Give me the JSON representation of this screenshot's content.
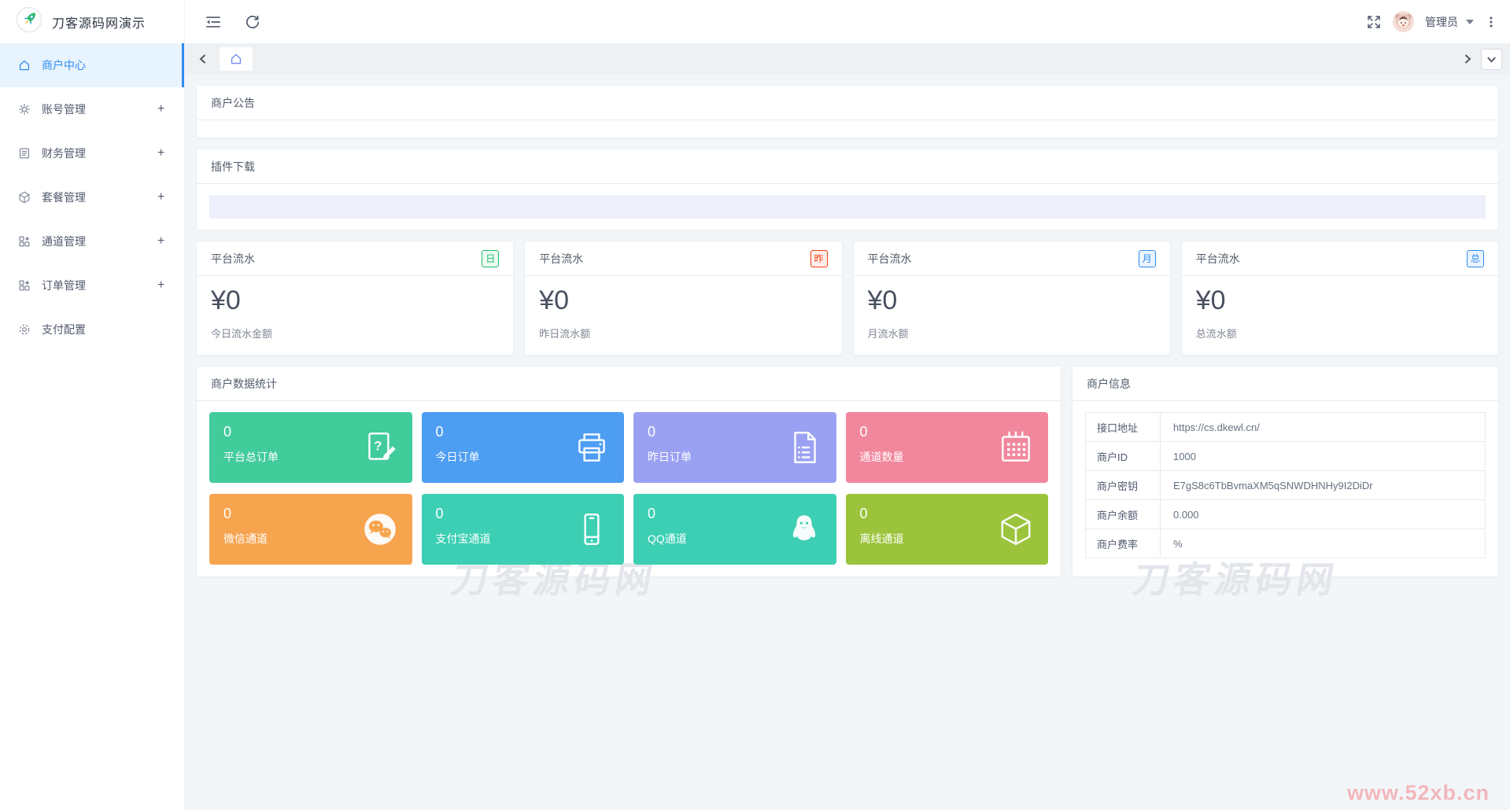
{
  "app": {
    "title": "刀客源码网演示"
  },
  "sidebar": {
    "items": [
      {
        "label": "商户中心",
        "expand": ""
      },
      {
        "label": "账号管理",
        "expand": "+"
      },
      {
        "label": "财务管理",
        "expand": "+"
      },
      {
        "label": "套餐管理",
        "expand": "+"
      },
      {
        "label": "通道管理",
        "expand": "+"
      },
      {
        "label": "订单管理",
        "expand": "+"
      },
      {
        "label": "支付配置",
        "expand": ""
      }
    ]
  },
  "header": {
    "user_name": "管理员"
  },
  "announcement": {
    "title": "商户公告"
  },
  "plugins": {
    "title": "插件下载"
  },
  "stat_cards": [
    {
      "title": "平台流水",
      "badge": "日",
      "badge_color": "#19be6b",
      "badge_bg": "#edf9f1",
      "value": "¥0",
      "label": "今日流水金额"
    },
    {
      "title": "平台流水",
      "badge": "昨",
      "badge_color": "#ed4014",
      "badge_bg": "#feeeeb",
      "value": "¥0",
      "label": "昨日流水额"
    },
    {
      "title": "平台流水",
      "badge": "月",
      "badge_color": "#2d8cf0",
      "badge_bg": "#eaf4fe",
      "value": "¥0",
      "label": "月流水额"
    },
    {
      "title": "平台流水",
      "badge": "总",
      "badge_color": "#2d8cf0",
      "badge_bg": "#eaf4fe",
      "value": "¥0",
      "label": "总流水额"
    }
  ],
  "data_stats": {
    "title": "商户数据统计",
    "tiles": [
      {
        "value": "0",
        "label": "平台总订单",
        "color": "#42cb9b",
        "icon": "order-edit-icon"
      },
      {
        "value": "0",
        "label": "今日订单",
        "color": "#4d9df2",
        "icon": "printer-icon"
      },
      {
        "value": "0",
        "label": "昨日订单",
        "color": "#9ba1f2",
        "icon": "document-icon"
      },
      {
        "value": "0",
        "label": "通道数量",
        "color": "#f1879d",
        "icon": "calendar-icon"
      },
      {
        "value": "0",
        "label": "微信通道",
        "color": "#f7a44f",
        "icon": "wechat-icon"
      },
      {
        "value": "0",
        "label": "支付宝通道",
        "color": "#3dcfb4",
        "icon": "phone-icon"
      },
      {
        "value": "0",
        "label": "QQ通道",
        "color": "#3dcfb4",
        "icon": "qq-icon"
      },
      {
        "value": "0",
        "label": "离线通道",
        "color": "#9bc43c",
        "icon": "package-icon"
      }
    ]
  },
  "merchant_info": {
    "title": "商户信息",
    "rows": [
      {
        "label": "接口地址",
        "value": "https://cs.dkewl.cn/"
      },
      {
        "label": "商户ID",
        "value": "1000"
      },
      {
        "label": "商户密钥",
        "value": "E7gS8c6TbBvmaXM5qSNWDHNHy9I2DiDr"
      },
      {
        "label": "商户余额",
        "value": "0.000"
      },
      {
        "label": "商户费率",
        "value": "%"
      }
    ]
  },
  "watermarks": {
    "site": "刀客源码网",
    "corner": "www.52xb.cn"
  }
}
